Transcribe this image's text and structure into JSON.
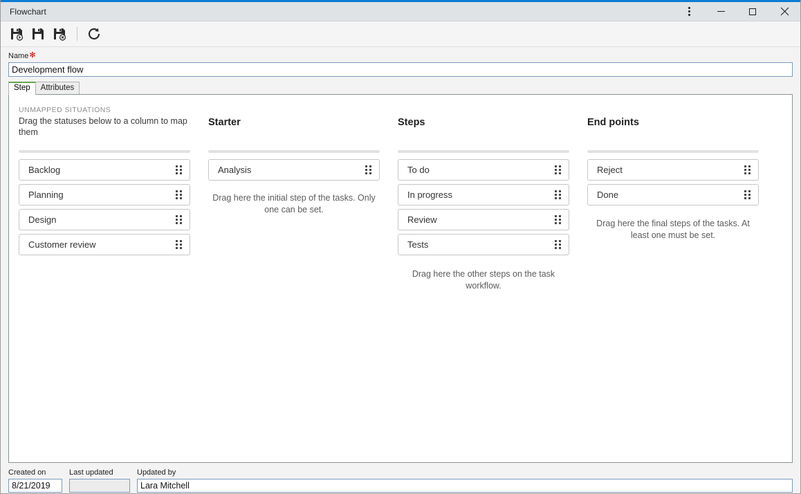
{
  "window": {
    "title": "Flowchart",
    "accent_color": "#0c7cd5",
    "controls": {
      "menu": "more-options",
      "minimize": "minimize",
      "maximize": "maximize",
      "close": "close"
    }
  },
  "toolbar": {
    "buttons": [
      {
        "name": "save-and-new",
        "title": "Save and new"
      },
      {
        "name": "save",
        "title": "Save"
      },
      {
        "name": "save-and-close",
        "title": "Save and close"
      },
      {
        "name": "refresh",
        "title": "Refresh"
      }
    ]
  },
  "form": {
    "name_label": "Name",
    "name_required_marker": "✻",
    "name_value": "Development flow",
    "name_placeholder": "Name"
  },
  "tabs": [
    {
      "label": "Step",
      "active": true
    },
    {
      "label": "Attributes",
      "active": false
    }
  ],
  "columns": {
    "unmapped": {
      "kicker": "UNMAPPED SITUATIONS",
      "subtitle": "Drag the statuses below to a column to map them",
      "items": [
        {
          "label": "Backlog"
        },
        {
          "label": "Planning"
        },
        {
          "label": "Design"
        },
        {
          "label": "Customer review"
        }
      ]
    },
    "starter": {
      "title": "Starter",
      "items": [
        {
          "label": "Analysis"
        }
      ],
      "hint": "Drag here the initial step of the tasks. Only one can be set."
    },
    "steps": {
      "title": "Steps",
      "items": [
        {
          "label": "To do"
        },
        {
          "label": "In progress"
        },
        {
          "label": "Review"
        },
        {
          "label": "Tests"
        }
      ],
      "hint": "Drag here the other steps on the task workflow."
    },
    "endpoints": {
      "title": "End points",
      "items": [
        {
          "label": "Reject"
        },
        {
          "label": "Done"
        }
      ],
      "hint": "Drag here the final steps of the tasks. At least one must be set."
    }
  },
  "footer": {
    "created_on_label": "Created on",
    "created_on_value": "8/21/2019",
    "last_updated_label": "Last updated",
    "last_updated_value": "",
    "updated_by_label": "Updated by",
    "updated_by_value": "Lara Mitchell"
  },
  "colors": {
    "accent": "#0c7cd5",
    "active_tab_underline": "#63a84b",
    "required": "#cc0000",
    "titlebar_bg": "#dfe3e6"
  }
}
